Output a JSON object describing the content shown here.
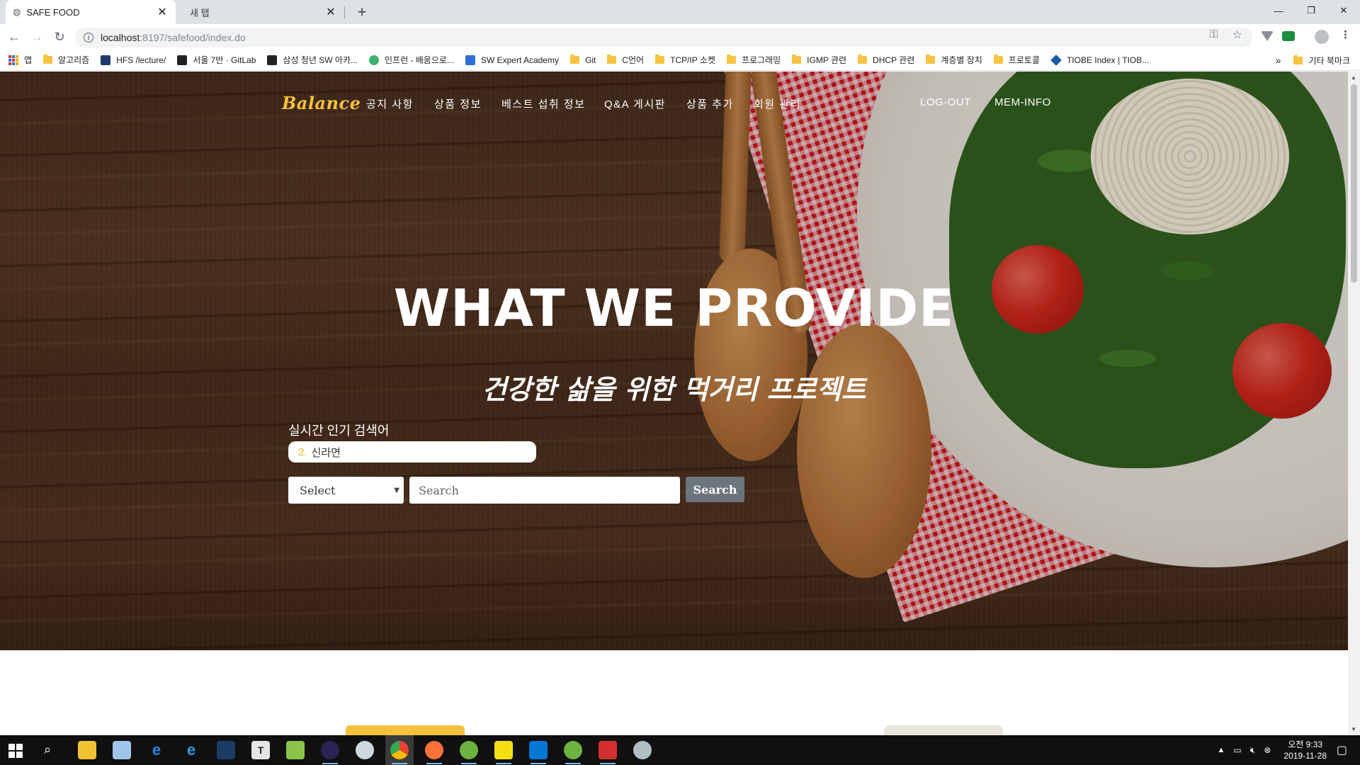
{
  "browser": {
    "tabs": [
      {
        "title": "SAFE FOOD",
        "active": true
      },
      {
        "title": "새 탭",
        "active": false
      }
    ],
    "new_tab_icon": "plus-icon",
    "url_host": "localhost",
    "url_path": ":8197/safefood/index.do",
    "bookmarks": [
      {
        "label": "앱",
        "icon": "apps-grid-icon"
      },
      {
        "label": "알고리즘",
        "icon": "folder-icon"
      },
      {
        "label": "HFS /lecture/",
        "icon": "hfs-icon"
      },
      {
        "label": "서울 7반 · GitLab",
        "icon": "gitlab-icon"
      },
      {
        "label": "삼성 청년 SW 아카...",
        "icon": "ssafy-icon"
      },
      {
        "label": "인프런 - 배움으로...",
        "icon": "inflearn-icon"
      },
      {
        "label": "SW Expert Academy",
        "icon": "swea-icon"
      },
      {
        "label": "Git",
        "icon": "folder-icon"
      },
      {
        "label": "C언어",
        "icon": "folder-icon"
      },
      {
        "label": "TCP/IP 소켓",
        "icon": "folder-icon"
      },
      {
        "label": "프로그래밍",
        "icon": "folder-icon"
      },
      {
        "label": "IGMP 관련",
        "icon": "folder-icon"
      },
      {
        "label": "DHCP 관련",
        "icon": "folder-icon"
      },
      {
        "label": "계층별 장치",
        "icon": "folder-icon"
      },
      {
        "label": "프로토콜",
        "icon": "folder-icon"
      },
      {
        "label": "TIOBE Index | TIOB...",
        "icon": "tiobe-icon"
      }
    ],
    "bookmarks_overflow": "»",
    "other_bookmarks": "기타 북마크"
  },
  "navbar": {
    "brand": "Balance",
    "links": [
      "공지 사항",
      "상품 정보",
      "베스트 섭취 정보",
      "Q&A 게시판",
      "상품 추가",
      "회원 관리"
    ],
    "logout": "LOG-OUT",
    "member_info": "MEM-INFO"
  },
  "hero": {
    "title": "WHAT WE PROVIDE",
    "subtitle": "건강한 삶을 위한 먹거리 프로젝트",
    "trending_label": "실시간 인기 검색어",
    "trending_rank": "2.",
    "trending_item": "신라면",
    "select_value": "Select",
    "search_placeholder": "Search",
    "search_button": "Search"
  },
  "taskbar": {
    "time": "오전 9:33",
    "date": "2019-11-28",
    "apps": [
      "file-explorer-icon",
      "notepad-icon",
      "edge-icon",
      "ie-icon",
      "terminal-icon",
      "typora-icon",
      "editor-icon",
      "eclipse-icon",
      "paint-icon",
      "chrome-icon",
      "firefox-icon",
      "spring-icon",
      "sticky-notes-icon",
      "vscode-icon",
      "spring-tool-icon",
      "acrobat-icon",
      "tool-icon"
    ]
  },
  "colors": {
    "brand": "#f6c23e",
    "search_button": "#6c757d",
    "trending_rank": "#f2b31b"
  }
}
